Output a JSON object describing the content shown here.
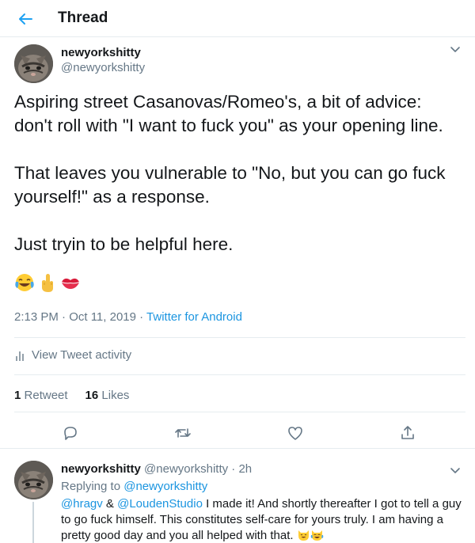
{
  "header": {
    "title": "Thread",
    "back_icon": "arrow-left-icon"
  },
  "colors": {
    "accent": "#1b95e0",
    "text": "#14171a",
    "muted": "#657786",
    "border": "#e6ecf0"
  },
  "tweet": {
    "author_name": "newyorkshitty",
    "author_handle": "@newyorkshitty",
    "text_lines": [
      "Aspiring street Casanovas/Romeo's, a bit of advice:",
      "don't roll with \"I want to fuck you\" as your opening line.",
      "That leaves you vulnerable to \"No, but you can go fuck",
      "yourself!\" as a response.",
      "Just tryin to be helpful here."
    ],
    "emojis": [
      "face-with-tears-of-joy",
      "middle-finger",
      "kiss-mark"
    ],
    "time": "2:13 PM · Oct 11, 2019 · ",
    "app": "Twitter for Android",
    "activity_label": "View Tweet activity",
    "retweet_count": "1",
    "retweet_label": "Retweet",
    "like_count": "16",
    "like_label": "Likes",
    "actions": [
      "reply-icon",
      "retweet-icon",
      "like-icon",
      "share-icon"
    ]
  },
  "reply": {
    "author_name": "newyorkshitty",
    "handle_time": "@newyorkshitty · 2h",
    "replying_prefix": "Replying to ",
    "replying_to": "@newyorkshitty",
    "mention1": "@hragv",
    "amp": " & ",
    "mention2": "@LoudenStudio",
    "text": " I made it! And shortly thereafter I got to tell a guy to go fuck himself. This constitutes self-care for yours truly. I am having a pretty good day and you all helped with that. ",
    "emojis": [
      "smiling-cat-icon",
      "cat-tears-of-joy-icon"
    ]
  }
}
